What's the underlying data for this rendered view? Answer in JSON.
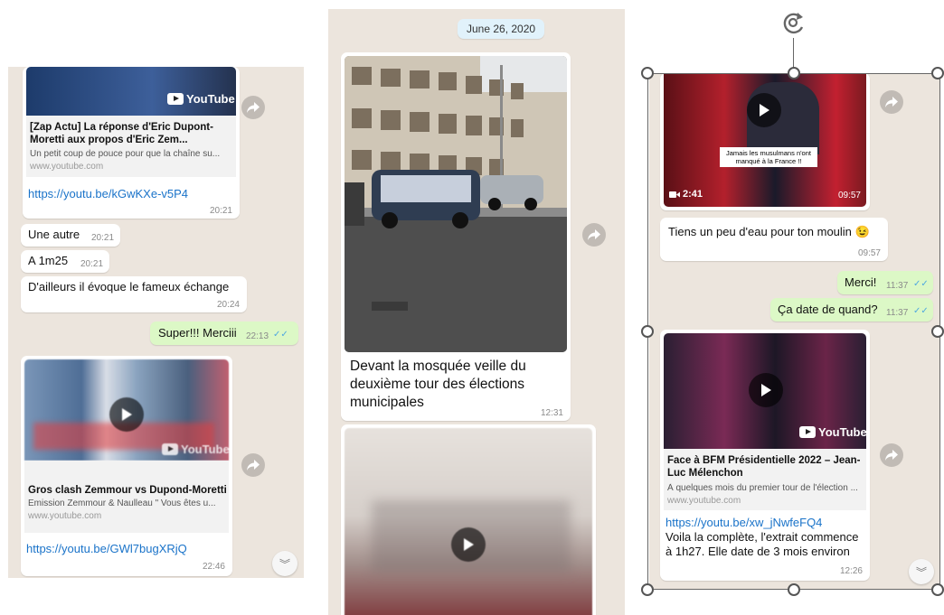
{
  "panel1": {
    "yt_label": "YouTube",
    "link1": {
      "title": "[Zap Actu] La réponse d'Eric Dupont-Moretti aux propos d'Eric Zem...",
      "desc": "Un petit coup de pouce pour que la chaîne su...",
      "domain": "www.youtube.com",
      "url": "https://youtu.be/kGwKXe-v5P4",
      "time": "20:21"
    },
    "msgs": [
      {
        "text": "Une autre",
        "time": "20:21"
      },
      {
        "text": "A 1m25",
        "time": "20:21"
      },
      {
        "text": "D'ailleurs il évoque le fameux échange",
        "time": "20:24"
      }
    ],
    "out1": {
      "text": "Super!!! Merciii",
      "time": "22:13"
    },
    "link2": {
      "title": "Gros clash Zemmour vs Dupond-Moretti",
      "desc": "Emission Zemmour & Naulleau \" Vous êtes u...",
      "domain": "www.youtube.com",
      "url": "https://youtu.be/GWl7bugXRjQ",
      "time": "22:46"
    }
  },
  "panel2": {
    "date": "June 26, 2020",
    "caption": "Devant la mosquée veille du deuxième tour des élections municipales",
    "time": "12:31"
  },
  "panel3": {
    "video": {
      "duration": "2:41",
      "time": "09:57",
      "overlay_text": "Jamais les musulmans n'ont manqué à la France !!"
    },
    "msg1": {
      "text": "Tiens un peu d'eau pour ton moulin 😉",
      "time": "09:57"
    },
    "out1": {
      "text": "Merci!",
      "time": "11:37"
    },
    "out2": {
      "text": "Ça date de quand?",
      "time": "11:37"
    },
    "yt_label": "YouTube",
    "link": {
      "title": "Face à BFM Présidentielle 2022 – Jean-Luc Mélenchon",
      "desc": "À quelques mois du premier tour de l'élection ...",
      "domain": "www.youtube.com",
      "url": "https://youtu.be/xw_jNwfeFQ4",
      "body": "Voila la complète, l'extrait commence à 1h27. Elle date de 3 mois environ",
      "time": "12:26"
    }
  },
  "colors": {
    "chat_bg": "#ece5dd",
    "outgoing": "#dcf8c6",
    "link": "#1a73c9",
    "read_ticks": "#4fa8e0"
  }
}
